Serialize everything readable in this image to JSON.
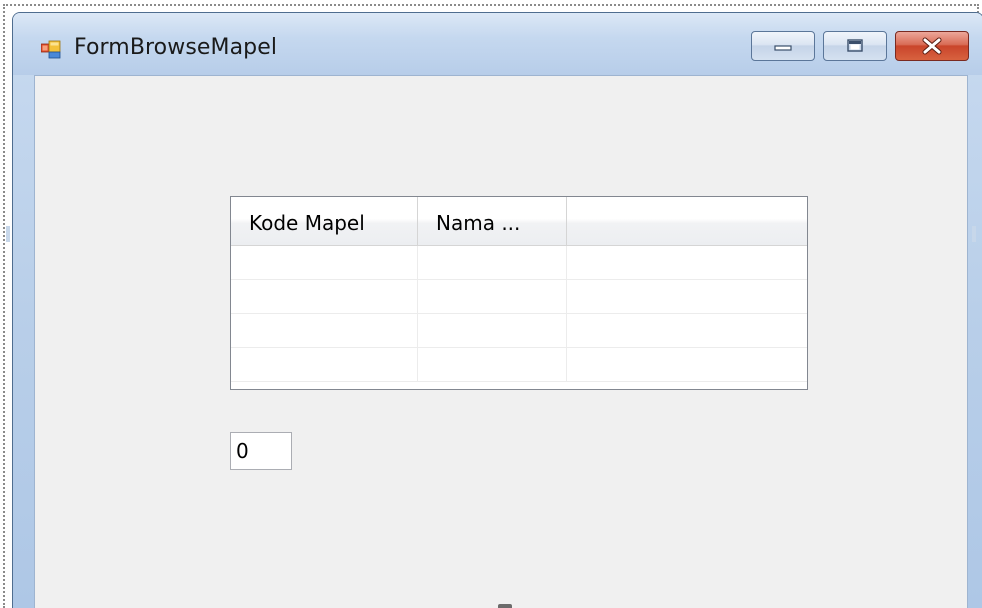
{
  "window": {
    "title": "FormBrowseMapel",
    "icon": "winforms-app-icon",
    "buttons": {
      "minimize_icon": "minimize-icon",
      "maximize_icon": "maximize-icon",
      "close_icon": "close-icon"
    },
    "colors": {
      "close_button": "#c9452b",
      "client_background": "#f0f0f0",
      "titlebar": "#c5d8ef"
    }
  },
  "grid": {
    "columns": [
      "Kode Mapel",
      "Nama ...",
      ""
    ],
    "rows": [
      [
        "",
        "",
        ""
      ],
      [
        "",
        "",
        ""
      ],
      [
        "",
        "",
        ""
      ],
      [
        "",
        "",
        ""
      ]
    ]
  },
  "count_field": {
    "value": "0"
  }
}
